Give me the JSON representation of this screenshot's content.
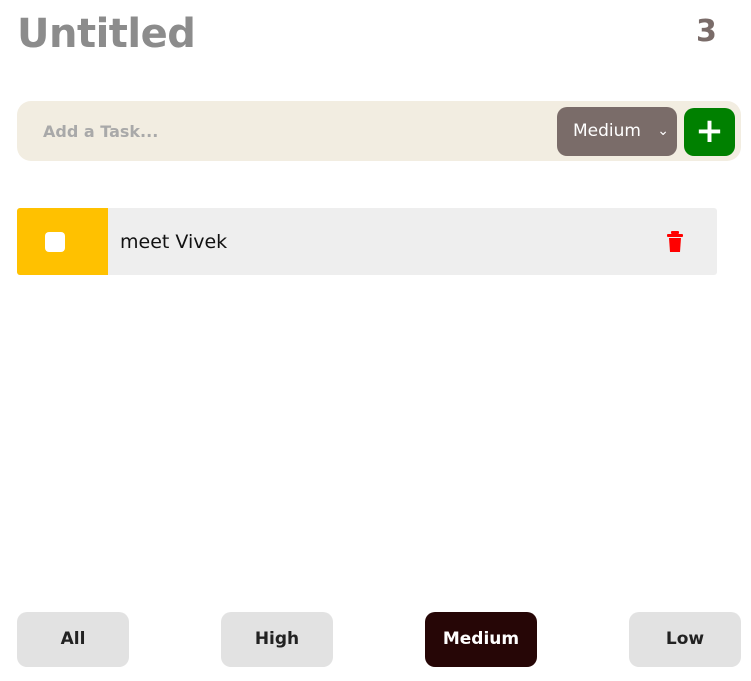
{
  "header": {
    "title": "Untitled",
    "count": "3"
  },
  "add_task": {
    "placeholder": "Add a Task...",
    "priority": "Medium",
    "add_label": "+"
  },
  "tasks": [
    {
      "text": "meet Vivek",
      "priority_color": "#ffc100",
      "done": false
    }
  ],
  "filters": {
    "items": [
      "All",
      "High",
      "Medium",
      "Low"
    ],
    "active": "Medium"
  },
  "colors": {
    "accent_green": "#008000",
    "select_bg": "#7a6c69",
    "active_filter": "#260606",
    "delete": "#ff0000"
  }
}
